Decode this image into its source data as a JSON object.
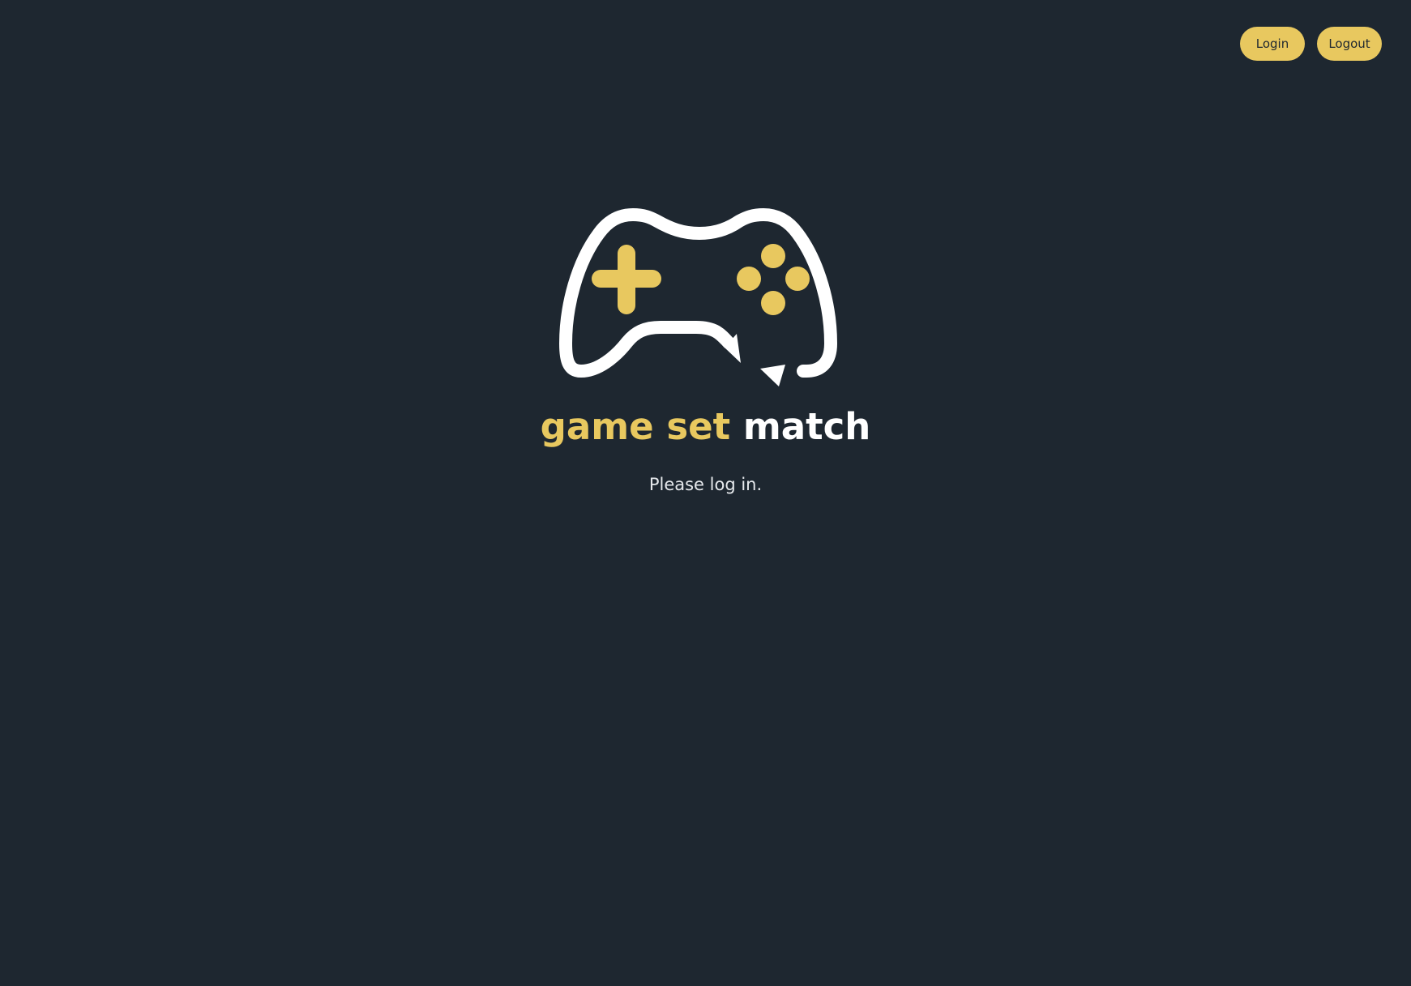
{
  "header": {
    "login_label": "Login",
    "logout_label": "Logout"
  },
  "logo": {
    "icon": "gamepad-icon",
    "word_game": "game",
    "word_set": "set",
    "word_match": "match"
  },
  "main": {
    "message": "Please log in."
  },
  "colors": {
    "background": "#1e2730",
    "accent": "#e8c85f",
    "text": "#ffffff"
  }
}
